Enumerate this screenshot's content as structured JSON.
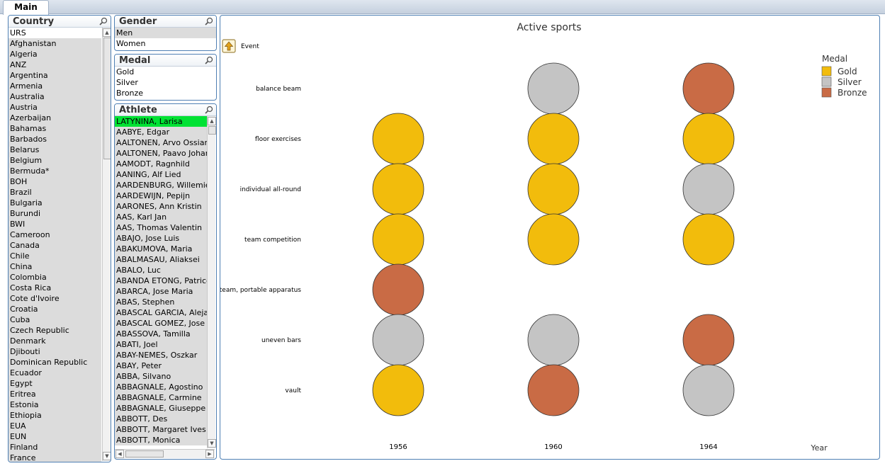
{
  "tabs": [
    {
      "label": "Main"
    }
  ],
  "listboxes": {
    "country": {
      "title": "Country",
      "items": [
        "URS",
        "Afghanistan",
        "Algeria",
        "ANZ",
        "Argentina",
        "Armenia",
        "Australia",
        "Austria",
        "Azerbaijan",
        "Bahamas",
        "Barbados",
        "Belarus",
        "Belgium",
        "Bermuda*",
        "BOH",
        "Brazil",
        "Bulgaria",
        "Burundi",
        "BWI",
        "Cameroon",
        "Canada",
        "Chile",
        "China",
        "Colombia",
        "Costa Rica",
        "Cote d'Ivoire",
        "Croatia",
        "Cuba",
        "Czech Republic",
        "Denmark",
        "Djibouti",
        "Dominican Republic",
        "Ecuador",
        "Egypt",
        "Eritrea",
        "Estonia",
        "Ethiopia",
        "EUA",
        "EUN",
        "Finland",
        "France"
      ]
    },
    "gender": {
      "title": "Gender",
      "items": [
        "Men",
        "Women"
      ]
    },
    "medal": {
      "title": "Medal",
      "items": [
        "Gold",
        "Silver",
        "Bronze"
      ]
    },
    "athlete": {
      "title": "Athlete",
      "items": [
        "LATYNINA, Larisa",
        "AABYE, Edgar",
        "AALTONEN, Arvo Ossian",
        "AALTONEN, Paavo Johannes",
        "AAMODT, Ragnhild",
        "AANING, Alf Lied",
        "AARDENBURG, Willemien",
        "AARDEWIJN, Pepijn",
        "AARONES, Ann Kristin",
        "AAS, Karl Jan",
        "AAS, Thomas Valentin",
        "ABAJO, Jose Luis",
        "ABAKUMOVA, Maria",
        "ABALMASAU, Aliaksei",
        "ABALO, Luc",
        "ABANDA ETONG, Patrice",
        "ABARCA, Jose Maria",
        "ABAS, Stephen",
        "ABASCAL GARCIA, Alejandro",
        "ABASCAL GOMEZ, Jose Manuel",
        "ABASSOVA, Tamilla",
        "ABATI, Joel",
        "ABAY-NEMES, Oszkar",
        "ABAY, Peter",
        "ABBA, Silvano",
        "ABBAGNALE, Agostino",
        "ABBAGNALE, Carmine",
        "ABBAGNALE, Giuseppe",
        "ABBOTT, Des",
        "ABBOTT, Margaret Ives",
        "ABBOTT, Monica"
      ]
    }
  },
  "colors": {
    "gold": "#f2bc0c",
    "silver": "#c4c4c4",
    "bronze": "#c96b45",
    "selected": "#00e234",
    "frame": "#4f80b4"
  },
  "chart_data": {
    "type": "scatter",
    "title": "Active sports",
    "dimension_label": "Event",
    "xlabel": "Year",
    "x_categories": [
      "1956",
      "1960",
      "1964"
    ],
    "y_categories": [
      "balance beam",
      "floor exercises",
      "individual all-round",
      "team competition",
      "team, portable apparatus",
      "uneven bars",
      "vault"
    ],
    "legend": {
      "title": "Medal",
      "position": "top-right",
      "entries": [
        "Gold",
        "Silver",
        "Bronze"
      ]
    },
    "points": [
      {
        "event": "balance beam",
        "year": "1960",
        "medal": "Silver"
      },
      {
        "event": "balance beam",
        "year": "1964",
        "medal": "Bronze"
      },
      {
        "event": "floor exercises",
        "year": "1956",
        "medal": "Gold"
      },
      {
        "event": "floor exercises",
        "year": "1960",
        "medal": "Gold"
      },
      {
        "event": "floor exercises",
        "year": "1964",
        "medal": "Gold"
      },
      {
        "event": "individual all-round",
        "year": "1956",
        "medal": "Gold"
      },
      {
        "event": "individual all-round",
        "year": "1960",
        "medal": "Gold"
      },
      {
        "event": "individual all-round",
        "year": "1964",
        "medal": "Silver"
      },
      {
        "event": "team competition",
        "year": "1956",
        "medal": "Gold"
      },
      {
        "event": "team competition",
        "year": "1960",
        "medal": "Gold"
      },
      {
        "event": "team competition",
        "year": "1964",
        "medal": "Gold"
      },
      {
        "event": "team, portable apparatus",
        "year": "1956",
        "medal": "Bronze"
      },
      {
        "event": "uneven bars",
        "year": "1956",
        "medal": "Silver"
      },
      {
        "event": "uneven bars",
        "year": "1960",
        "medal": "Silver"
      },
      {
        "event": "uneven bars",
        "year": "1964",
        "medal": "Bronze"
      },
      {
        "event": "vault",
        "year": "1956",
        "medal": "Gold"
      },
      {
        "event": "vault",
        "year": "1960",
        "medal": "Bronze"
      },
      {
        "event": "vault",
        "year": "1964",
        "medal": "Silver"
      }
    ]
  }
}
